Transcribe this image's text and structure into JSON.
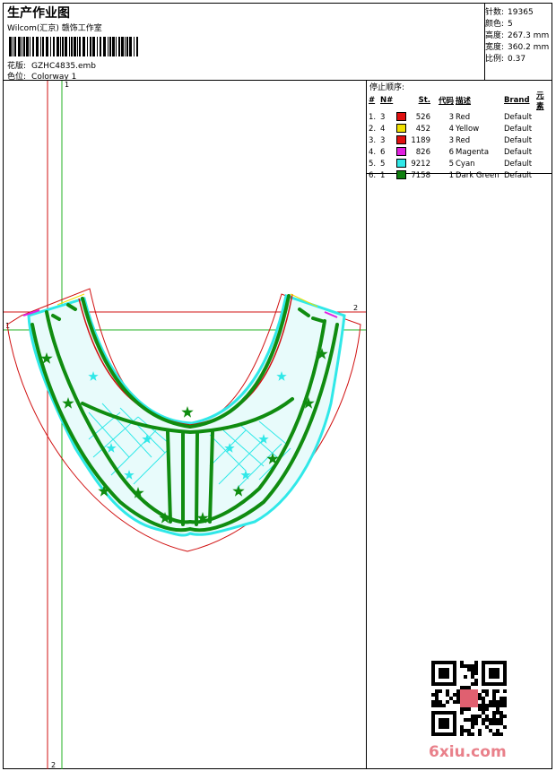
{
  "header": {
    "title": "生产作业图",
    "studio": "Wilcom(汇京) 赣饰工作室",
    "design_label": "花版:",
    "design_value": "GZHC4835.emb",
    "colorway_label": "色位:",
    "colorway_value": "Colorway 1"
  },
  "stats": [
    {
      "label": "针数:",
      "value": "19365"
    },
    {
      "label": "颜色:",
      "value": "5"
    },
    {
      "label": "高度:",
      "value": "267.3 mm"
    },
    {
      "label": "宽度:",
      "value": "360.2 mm"
    },
    {
      "label": "比例:",
      "value": "0.37"
    }
  ],
  "sequence": {
    "title": "停止顺序:",
    "headers": [
      "#",
      "N#",
      "St.",
      "代码",
      "描述",
      "Brand",
      "元素"
    ],
    "rows": [
      {
        "num": "1.",
        "n": "3",
        "color": "#e01010",
        "st": "526",
        "code": "3",
        "desc": "Red",
        "brand": "Default"
      },
      {
        "num": "2.",
        "n": "4",
        "color": "#f0e000",
        "st": "452",
        "code": "4",
        "desc": "Yellow",
        "brand": "Default"
      },
      {
        "num": "3.",
        "n": "3",
        "color": "#e01010",
        "st": "1189",
        "code": "3",
        "desc": "Red",
        "brand": "Default"
      },
      {
        "num": "4.",
        "n": "6",
        "color": "#e020e0",
        "st": "826",
        "code": "6",
        "desc": "Magenta",
        "brand": "Default"
      },
      {
        "num": "5.",
        "n": "5",
        "color": "#30e8e8",
        "st": "9212",
        "code": "5",
        "desc": "Cyan",
        "brand": "Default"
      },
      {
        "num": "6.",
        "n": "1",
        "color": "#108010",
        "st": "7158",
        "code": "1",
        "desc": "Dark Green",
        "brand": "Default"
      }
    ]
  },
  "guides": {
    "v1": "1",
    "v2": "2",
    "h2": "2",
    "h1": "1"
  },
  "watermark": "6xiu.com",
  "colors": {
    "red": "#d01010",
    "green": "#108c10",
    "cyan": "#30e8e8",
    "magenta": "#e020e0"
  }
}
